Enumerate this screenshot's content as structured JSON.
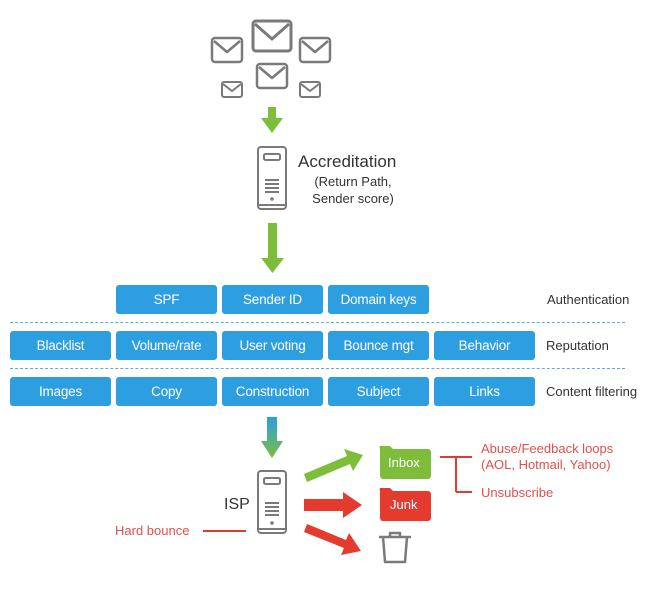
{
  "colors": {
    "button_blue": "#2d9fe0",
    "arrow_green": "#7dbd3a",
    "arrow_red": "#e53b2f",
    "label_red": "#e0504c",
    "icon_gray": "#7a7a7a"
  },
  "icons": {
    "mail": "envelope-icon",
    "server": "server-icon",
    "trash": "trash-icon",
    "folder": "folder-icon"
  },
  "accreditation": {
    "title": "Accreditation",
    "subtitle_line1": "(Return Path,",
    "subtitle_line2": "Sender score)"
  },
  "rows": {
    "authentication": {
      "label": "Authentication",
      "items": [
        "SPF",
        "Sender ID",
        "Domain keys"
      ]
    },
    "reputation": {
      "label": "Reputation",
      "items": [
        "Blacklist",
        "Volume/rate",
        "User voting",
        "Bounce mgt",
        "Behavior"
      ]
    },
    "content_filtering": {
      "label": "Content filtering",
      "items": [
        "Images",
        "Copy",
        "Construction",
        "Subject",
        "Links"
      ]
    }
  },
  "isp": {
    "label": "ISP",
    "hard_bounce": "Hard bounce"
  },
  "destinations": {
    "inbox": "Inbox",
    "junk": "Junk",
    "trash": "Trash"
  },
  "inbox_notes": {
    "feedback_line1": "Abuse/Feedback loops",
    "feedback_line2": "(AOL, Hotmail, Yahoo)",
    "unsubscribe": "Unsubscribe"
  }
}
